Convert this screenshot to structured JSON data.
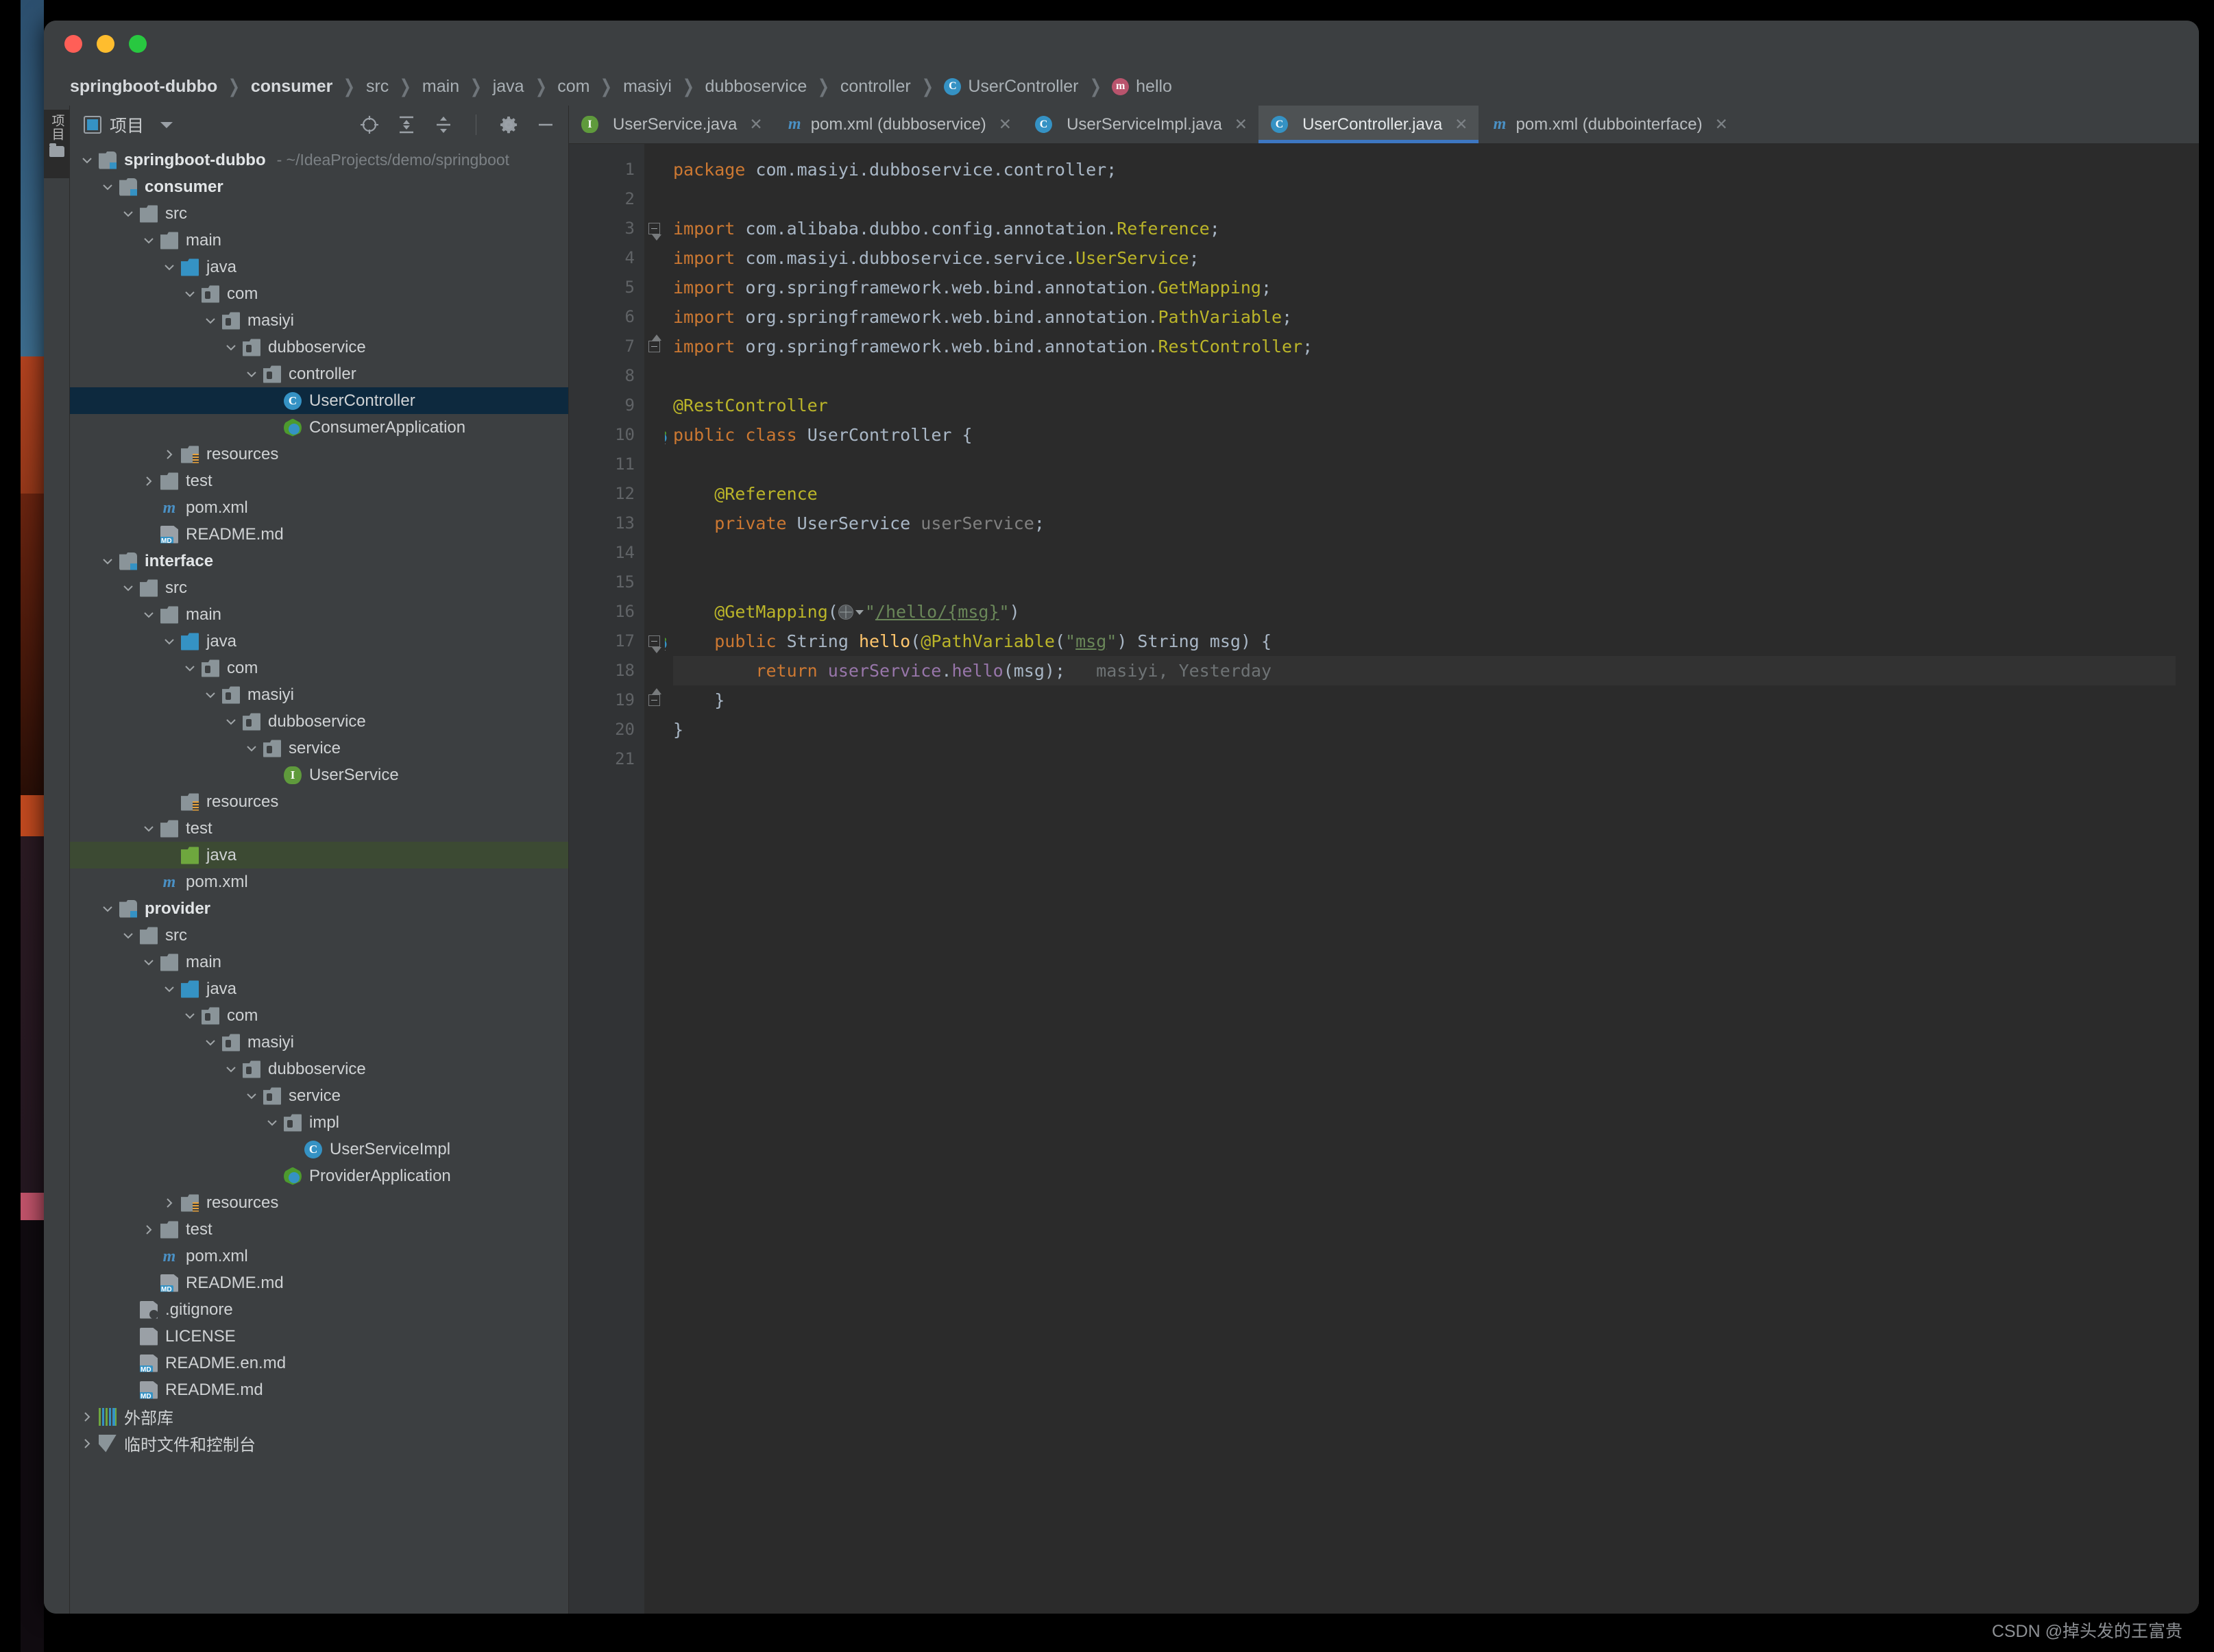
{
  "window": {
    "traffic_lights": [
      "close",
      "minimize",
      "maximize"
    ]
  },
  "breadcrumb": [
    {
      "label": "springboot-dubbo",
      "bold": true,
      "icon": ""
    },
    {
      "label": "consumer",
      "bold": true,
      "icon": ""
    },
    {
      "label": "src",
      "bold": false,
      "icon": ""
    },
    {
      "label": "main",
      "bold": false,
      "icon": ""
    },
    {
      "label": "java",
      "bold": false,
      "icon": ""
    },
    {
      "label": "com",
      "bold": false,
      "icon": ""
    },
    {
      "label": "masiyi",
      "bold": false,
      "icon": ""
    },
    {
      "label": "dubboservice",
      "bold": false,
      "icon": ""
    },
    {
      "label": "controller",
      "bold": false,
      "icon": ""
    },
    {
      "label": "UserController",
      "bold": false,
      "icon": "class"
    },
    {
      "label": "hello",
      "bold": false,
      "icon": "method"
    }
  ],
  "toolstrip": {
    "project_tab_label": "项目"
  },
  "project_panel": {
    "title": "项目",
    "tools": [
      "locate-icon",
      "expand-all-icon",
      "collapse-all-icon",
      "settings-gear-icon",
      "minimize-icon"
    ]
  },
  "tree": [
    {
      "label": "springboot-dubbo",
      "path": "- ~/IdeaProjects/demo/springboot",
      "depth": 0,
      "arrow": "down",
      "icon": "module",
      "bold": true
    },
    {
      "label": "consumer",
      "depth": 1,
      "arrow": "down",
      "icon": "module",
      "bold": true
    },
    {
      "label": "src",
      "depth": 2,
      "arrow": "down",
      "icon": "folder"
    },
    {
      "label": "main",
      "depth": 3,
      "arrow": "down",
      "icon": "folder"
    },
    {
      "label": "java",
      "depth": 4,
      "arrow": "down",
      "icon": "source"
    },
    {
      "label": "com",
      "depth": 5,
      "arrow": "down",
      "icon": "package"
    },
    {
      "label": "masiyi",
      "depth": 6,
      "arrow": "down",
      "icon": "package"
    },
    {
      "label": "dubboservice",
      "depth": 7,
      "arrow": "down",
      "icon": "package"
    },
    {
      "label": "controller",
      "depth": 8,
      "arrow": "down",
      "icon": "package"
    },
    {
      "label": "UserController",
      "depth": 9,
      "arrow": "none",
      "icon": "class",
      "state": "selected"
    },
    {
      "label": "ConsumerApplication",
      "depth": 9,
      "arrow": "none",
      "icon": "spring"
    },
    {
      "label": "resources",
      "depth": 4,
      "arrow": "right",
      "icon": "resources"
    },
    {
      "label": "test",
      "depth": 3,
      "arrow": "right",
      "icon": "folder"
    },
    {
      "label": "pom.xml",
      "depth": 3,
      "arrow": "none",
      "icon": "maven"
    },
    {
      "label": "README.md",
      "depth": 3,
      "arrow": "none",
      "icon": "markdown"
    },
    {
      "label": "interface",
      "depth": 1,
      "arrow": "down",
      "icon": "module",
      "bold": true
    },
    {
      "label": "src",
      "depth": 2,
      "arrow": "down",
      "icon": "folder"
    },
    {
      "label": "main",
      "depth": 3,
      "arrow": "down",
      "icon": "folder"
    },
    {
      "label": "java",
      "depth": 4,
      "arrow": "down",
      "icon": "source"
    },
    {
      "label": "com",
      "depth": 5,
      "arrow": "down",
      "icon": "package"
    },
    {
      "label": "masiyi",
      "depth": 6,
      "arrow": "down",
      "icon": "package"
    },
    {
      "label": "dubboservice",
      "depth": 7,
      "arrow": "down",
      "icon": "package"
    },
    {
      "label": "service",
      "depth": 8,
      "arrow": "down",
      "icon": "package"
    },
    {
      "label": "UserService",
      "depth": 9,
      "arrow": "none",
      "icon": "interface"
    },
    {
      "label": "resources",
      "depth": 4,
      "arrow": "none",
      "icon": "resources"
    },
    {
      "label": "test",
      "depth": 3,
      "arrow": "down",
      "icon": "folder"
    },
    {
      "label": "java",
      "depth": 4,
      "arrow": "none",
      "icon": "testsource",
      "state": "highlight"
    },
    {
      "label": "pom.xml",
      "depth": 3,
      "arrow": "none",
      "icon": "maven"
    },
    {
      "label": "provider",
      "depth": 1,
      "arrow": "down",
      "icon": "module",
      "bold": true
    },
    {
      "label": "src",
      "depth": 2,
      "arrow": "down",
      "icon": "folder"
    },
    {
      "label": "main",
      "depth": 3,
      "arrow": "down",
      "icon": "folder"
    },
    {
      "label": "java",
      "depth": 4,
      "arrow": "down",
      "icon": "source"
    },
    {
      "label": "com",
      "depth": 5,
      "arrow": "down",
      "icon": "package"
    },
    {
      "label": "masiyi",
      "depth": 6,
      "arrow": "down",
      "icon": "package"
    },
    {
      "label": "dubboservice",
      "depth": 7,
      "arrow": "down",
      "icon": "package"
    },
    {
      "label": "service",
      "depth": 8,
      "arrow": "down",
      "icon": "package"
    },
    {
      "label": "impl",
      "depth": 9,
      "arrow": "down",
      "icon": "package"
    },
    {
      "label": "UserServiceImpl",
      "depth": 10,
      "arrow": "none",
      "icon": "class"
    },
    {
      "label": "ProviderApplication",
      "depth": 9,
      "arrow": "none",
      "icon": "spring"
    },
    {
      "label": "resources",
      "depth": 4,
      "arrow": "right",
      "icon": "resources"
    },
    {
      "label": "test",
      "depth": 3,
      "arrow": "right",
      "icon": "folder"
    },
    {
      "label": "pom.xml",
      "depth": 3,
      "arrow": "none",
      "icon": "maven"
    },
    {
      "label": "README.md",
      "depth": 3,
      "arrow": "none",
      "icon": "markdown"
    },
    {
      "label": ".gitignore",
      "depth": 2,
      "arrow": "none",
      "icon": "gitignore"
    },
    {
      "label": "LICENSE",
      "depth": 2,
      "arrow": "none",
      "icon": "file"
    },
    {
      "label": "README.en.md",
      "depth": 2,
      "arrow": "none",
      "icon": "markdown"
    },
    {
      "label": "README.md",
      "depth": 2,
      "arrow": "none",
      "icon": "markdown"
    },
    {
      "label": "外部库",
      "depth": 0,
      "arrow": "right",
      "icon": "library"
    },
    {
      "label": "临时文件和控制台",
      "depth": 0,
      "arrow": "right",
      "icon": "scratch"
    }
  ],
  "tabs": [
    {
      "label": "UserService.java",
      "icon": "interface",
      "active": false
    },
    {
      "label": "pom.xml (dubboservice)",
      "icon": "maven",
      "active": false
    },
    {
      "label": "UserServiceImpl.java",
      "icon": "class",
      "active": false
    },
    {
      "label": "UserController.java",
      "icon": "class",
      "active": true
    },
    {
      "label": "pom.xml (dubbointerface)",
      "icon": "maven",
      "active": false
    }
  ],
  "editor": {
    "line_numbers": [
      1,
      2,
      3,
      4,
      5,
      6,
      7,
      8,
      9,
      10,
      11,
      12,
      13,
      14,
      15,
      16,
      17,
      18,
      19,
      20,
      21
    ],
    "caret_line": 18,
    "gutter_run_lines": [
      10,
      17
    ],
    "blame_annotation": "masiyi, Yesterday",
    "lines": [
      {
        "n": 1,
        "text": "package com.masiyi.dubboservice.controller;"
      },
      {
        "n": 2,
        "text": ""
      },
      {
        "n": 3,
        "text": "import com.alibaba.dubbo.config.annotation.Reference;"
      },
      {
        "n": 4,
        "text": "import com.masiyi.dubboservice.service.UserService;"
      },
      {
        "n": 5,
        "text": "import org.springframework.web.bind.annotation.GetMapping;"
      },
      {
        "n": 6,
        "text": "import org.springframework.web.bind.annotation.PathVariable;"
      },
      {
        "n": 7,
        "text": "import org.springframework.web.bind.annotation.RestController;"
      },
      {
        "n": 8,
        "text": ""
      },
      {
        "n": 9,
        "text": "@RestController"
      },
      {
        "n": 10,
        "text": "public class UserController {"
      },
      {
        "n": 11,
        "text": ""
      },
      {
        "n": 12,
        "text": "    @Reference"
      },
      {
        "n": 13,
        "text": "    private UserService userService;"
      },
      {
        "n": 14,
        "text": ""
      },
      {
        "n": 15,
        "text": ""
      },
      {
        "n": 16,
        "text": "    @GetMapping(\"/hello/{msg}\")"
      },
      {
        "n": 17,
        "text": "    public String hello(@PathVariable(\"msg\") String msg) {"
      },
      {
        "n": 18,
        "text": "        return userService.hello(msg);"
      },
      {
        "n": 19,
        "text": "    }"
      },
      {
        "n": 20,
        "text": "}"
      },
      {
        "n": 21,
        "text": ""
      }
    ]
  },
  "watermark": "CSDN @掉头发的王富贵",
  "colors": {
    "background": "#2b2b2b",
    "panel": "#3c3f41",
    "accent": "#3d77c2",
    "selection": "#0d293e",
    "highlight": "#3c4a33",
    "keyword": "#cc7832",
    "annotation": "#bbb529",
    "string": "#6a8759",
    "method": "#ffc66d",
    "field": "#9876aa"
  }
}
